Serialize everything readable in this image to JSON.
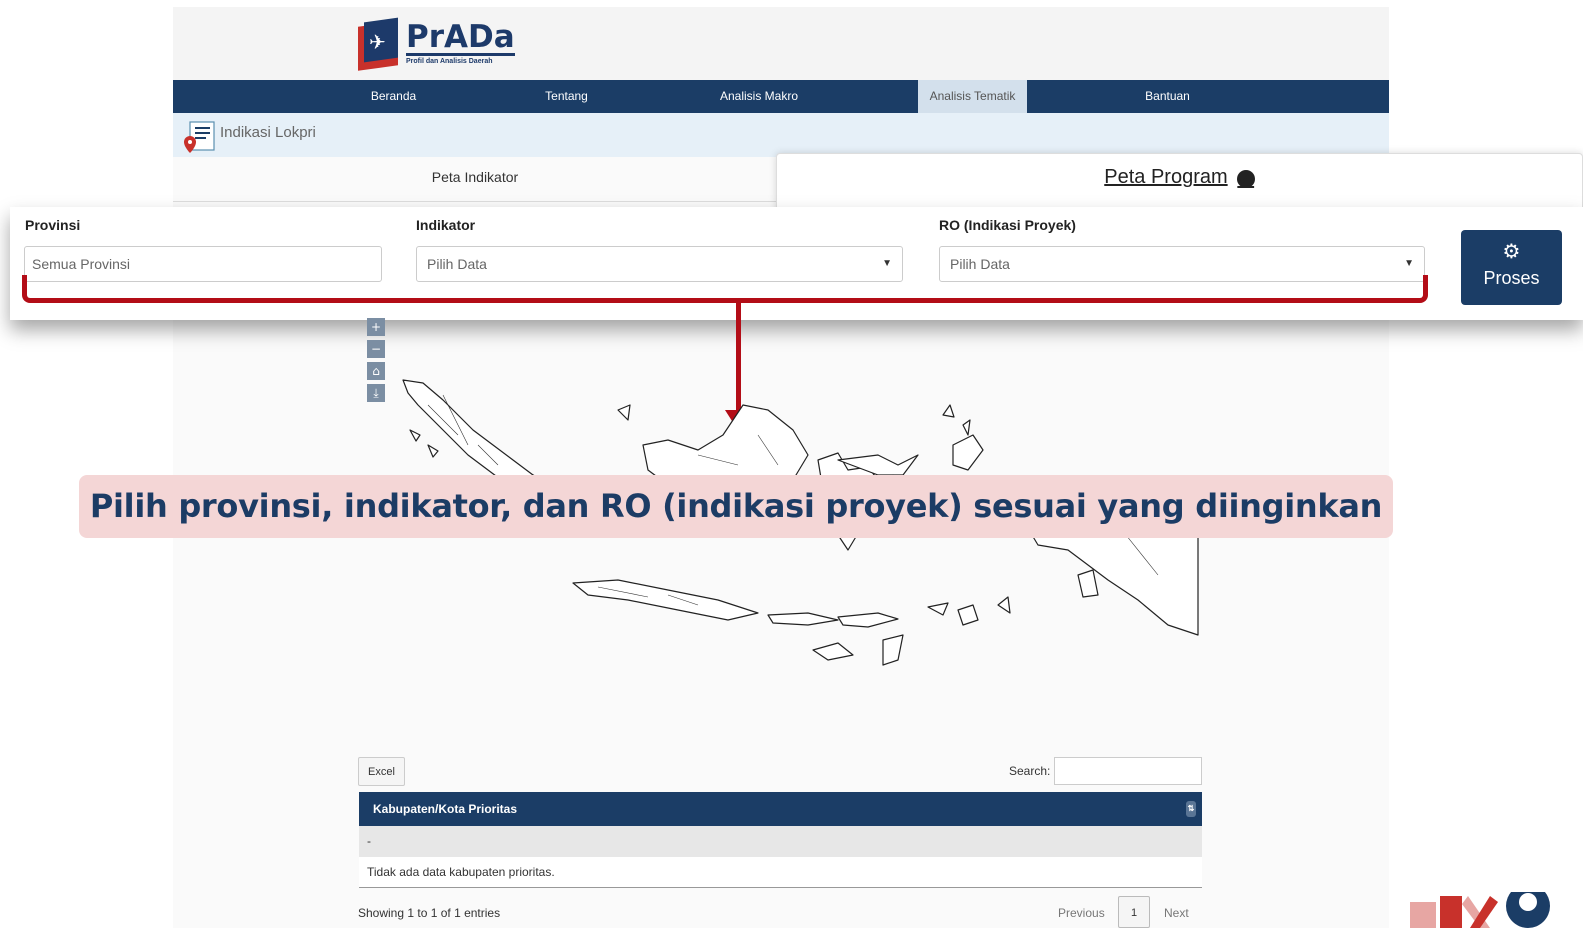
{
  "header": {
    "logo_title": "PrADa",
    "logo_subtitle": "Profil dan Analisis Daerah"
  },
  "nav": {
    "items": [
      "Beranda",
      "Tentang",
      "Analisis Makro",
      "Analisis Tematik",
      "Bantuan"
    ],
    "active": "Analisis Tematik"
  },
  "subheader": {
    "title": "Indikasi Lokpri"
  },
  "tabs": {
    "indikator": "Peta Indikator",
    "program": "Peta Program"
  },
  "filters": {
    "provinsi_label": "Provinsi",
    "provinsi_value": "Semua Provinsi",
    "indikator_label": "Indikator",
    "indikator_value": "Pilih Data",
    "ro_label": "RO (Indikasi Proyek)",
    "ro_value": "Pilih Data",
    "proses_label": "Proses"
  },
  "map_controls": [
    "+",
    "−",
    "home-icon",
    "download-icon"
  ],
  "banner": "Pilih provinsi, indikator, dan RO (indikasi proyek) sesuai yang diinginkan",
  "table": {
    "excel_label": "Excel",
    "search_label": "Search:",
    "header": "Kabupaten/Kota Prioritas",
    "rows": [
      "-",
      "Tidak ada data kabupaten prioritas."
    ],
    "info": "Showing 1 to 1 of 1 entries",
    "prev": "Previous",
    "page": "1",
    "next": "Next"
  },
  "colors": {
    "navy": "#1b3d66",
    "accent_red": "#b30d17",
    "banner_bg": "#f4d6d6"
  }
}
